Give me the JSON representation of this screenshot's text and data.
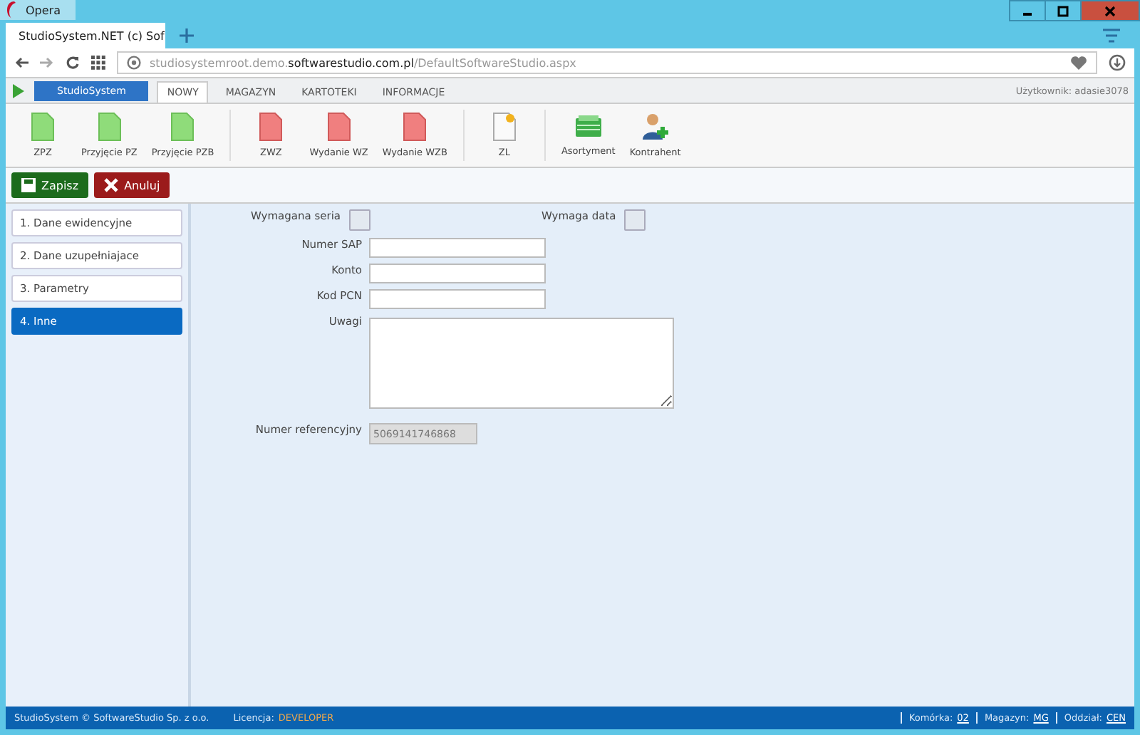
{
  "browser": {
    "app_name": "Opera",
    "tab_title": "StudioSystem.NET (c) Sof",
    "url_prefix": "studiosystemroot.demo.",
    "url_domain": "softwarestudio.com.pl",
    "url_path": "/DefaultSoftwareStudio.aspx"
  },
  "app_tabs": [
    {
      "label": "StudioSystem",
      "kind": "brand",
      "selected": false
    },
    {
      "label": "NOWY",
      "kind": "tab",
      "selected": true
    },
    {
      "label": "MAGAZYN",
      "kind": "tab",
      "selected": false
    },
    {
      "label": "KARTOTEKI",
      "kind": "tab",
      "selected": false
    },
    {
      "label": "INFORMACJE",
      "kind": "tab",
      "selected": false
    }
  ],
  "user_label": "Użytkownik: adasie3078",
  "ribbon_groups": [
    [
      {
        "label": "ZPZ",
        "kind": "green"
      },
      {
        "label": "Przyjęcie PZ",
        "kind": "green"
      },
      {
        "label": "Przyjęcie PZB",
        "kind": "green"
      }
    ],
    [
      {
        "label": "ZWZ",
        "kind": "red"
      },
      {
        "label": "Wydanie WZ",
        "kind": "red"
      },
      {
        "label": "Wydanie WZB",
        "kind": "red"
      }
    ],
    [
      {
        "label": "ZL",
        "kind": "note"
      }
    ],
    [
      {
        "label": "Asortyment",
        "kind": "box"
      },
      {
        "label": "Kontrahent",
        "kind": "person"
      }
    ]
  ],
  "actions": [
    {
      "label": "Zapisz",
      "kind": "save"
    },
    {
      "label": "Anuluj",
      "kind": "cancel"
    }
  ],
  "steps": [
    {
      "label": "1. Dane ewidencyjne",
      "selected": false
    },
    {
      "label": "2. Dane uzupełniajace",
      "selected": false
    },
    {
      "label": "3. Parametry",
      "selected": false
    },
    {
      "label": "4. Inne",
      "selected": true
    }
  ],
  "form": {
    "checkboxes": [
      {
        "label": "Wymagana seria",
        "checked": false
      },
      {
        "label": "Wymaga data",
        "checked": false
      }
    ],
    "fields": [
      {
        "label": "Numer SAP",
        "kind": "text"
      },
      {
        "label": "Konto",
        "kind": "text"
      },
      {
        "label": "Kod PCN",
        "kind": "text"
      },
      {
        "label": "Uwagi",
        "kind": "textarea"
      },
      {
        "label": "Numer referencyjny",
        "kind": "readonly",
        "value": "5069141746868"
      }
    ]
  },
  "status_bar": {
    "copyright": "StudioSystem © SoftwareStudio Sp. z o.o.",
    "license_label": "Licencja:",
    "license_value": "DEVELOPER",
    "items": [
      {
        "label": "Komórka:",
        "value": "02"
      },
      {
        "label": "Magazyn:",
        "value": "MG"
      },
      {
        "label": "Oddział:",
        "value": "CEN"
      }
    ]
  }
}
